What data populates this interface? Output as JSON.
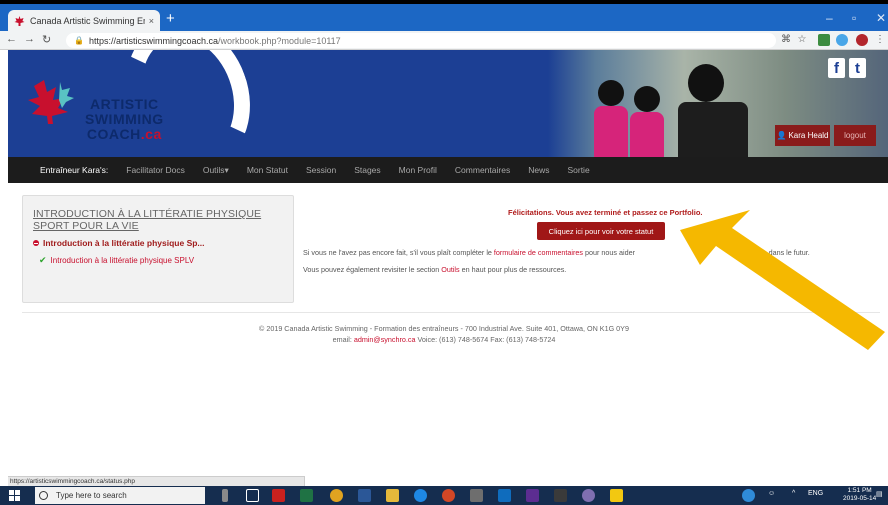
{
  "browser": {
    "tab_title": "Canada Artistic Swimming Entrai",
    "tab_close": "×",
    "new_tab": "+",
    "url_main": "https://artisticswimmingcoach.ca",
    "url_rest": "/workbook.php?module=10117",
    "status_url": "https://artisticswimmingcoach.ca/status.php"
  },
  "header": {
    "logo_line1": "ARTISTIC",
    "logo_line2": "SWIMMING",
    "logo_line3": "COACH",
    "logo_suffix": ".ca",
    "social_f": "f",
    "social_t": "t",
    "user_label": "Kara Heald",
    "logout_label": "logout"
  },
  "menu": {
    "items": [
      "Entraîneur Kara's:",
      "Facilitator Docs",
      "Outils▾",
      "Mon Statut",
      "Session",
      "Stages",
      "Mon Profil",
      "Commentaires",
      "News",
      "Sortie"
    ]
  },
  "sidebar": {
    "heading": "INTRODUCTION À LA LITTÉRATIE PHYSIQUE SPORT POUR LA VIE",
    "module_title": "Introduction à la littératie physique Sp...",
    "module_item": "Introduction à la littératie physique SPLV"
  },
  "main": {
    "congrats": "Félicitations. Vous avez terminé et passez ce Portfolio.",
    "status_button": "Cliquez ici pour voir votre statut",
    "para1_before": "Si vous ne l'avez pas encore fait, s'il vous plaît compléter le",
    "para1_link": "formulaire de commentaires",
    "para1_after": "pour nous aider",
    "para1_tail": "s dans le futur.",
    "para2_before": "Vous pouvez également revisiter le section",
    "para2_link": "Outils",
    "para2_after": "en haut pour plus de ressources."
  },
  "footer": {
    "line1": "© 2019 Canada Artistic Swimming - Formation des entraîneurs - 700 Industrial Ave. Suite 401, Ottawa, ON K1G 0Y9",
    "line2_before": "email:",
    "line2_email": "admin@synchro.ca",
    "line2_after": "Voice: (613) 748-5674 Fax: (613) 748-5724"
  },
  "taskbar": {
    "search_placeholder": "Type here to search",
    "lang": "ENG",
    "time": "1:51 PM",
    "date": "2019-05-14"
  },
  "colors": {
    "banner_blue": "#1c3f94",
    "accent_red": "#a01717",
    "arrow_yellow": "#f5b800"
  }
}
